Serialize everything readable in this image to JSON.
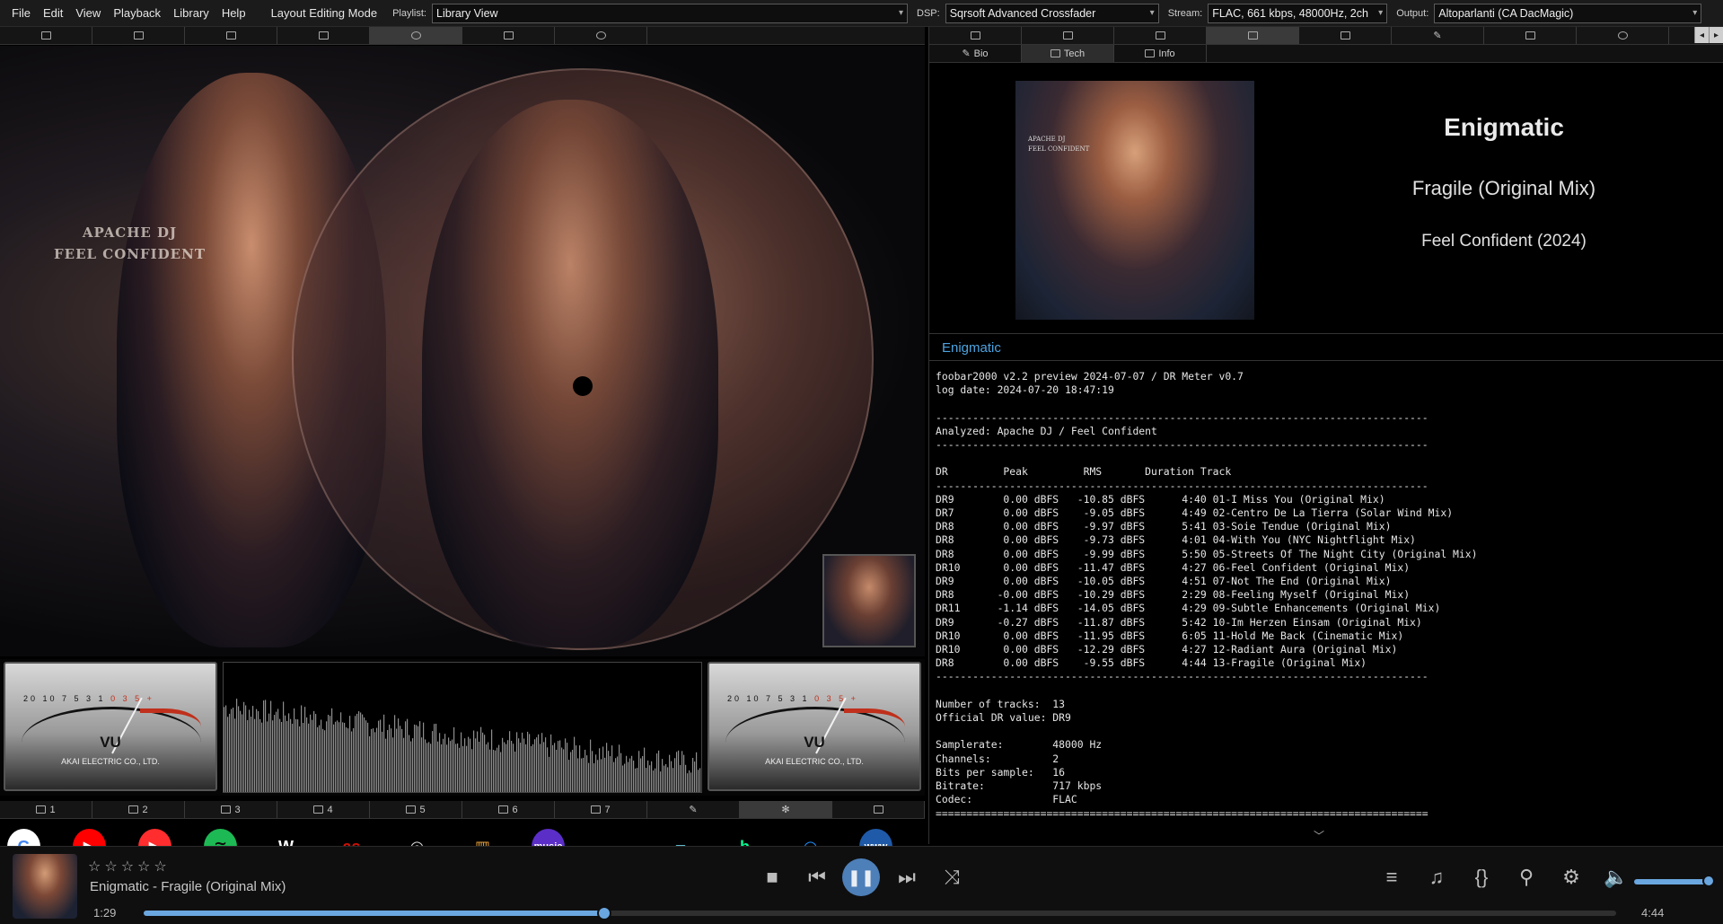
{
  "menubar": {
    "items": [
      "File",
      "Edit",
      "View",
      "Playback",
      "Library",
      "Help"
    ],
    "layout_mode": "Layout Editing Mode",
    "playlist_label": "Playlist:",
    "playlist_value": "Library View",
    "dsp_label": "DSP:",
    "dsp_value": "Sqrsoft Advanced Crossfader",
    "stream_label": "Stream:",
    "stream_value": "FLAC, 661 kbps, 48000Hz, 2ch",
    "output_label": "Output:",
    "output_value": "Altoparlanti (CA DacMagic)"
  },
  "artwork": {
    "caption_line1": "APACHE DJ",
    "caption_line2": "FEEL CONFIDENT"
  },
  "meters": {
    "vu_label": "VU",
    "brand": "AKAI ELECTRIC CO., LTD.",
    "scale": "20 10 7 5 3 1",
    "scale_red": "0 3 5 +"
  },
  "left_bottom_tabs": [
    "1",
    "2",
    "3",
    "4",
    "5",
    "6",
    "7",
    "",
    "",
    ""
  ],
  "services": [
    {
      "name": "google",
      "glyph": "G",
      "bg": "#ffffff",
      "fg": "#4285f4"
    },
    {
      "name": "youtube",
      "glyph": "▶",
      "bg": "#ff0000",
      "fg": "#ffffff"
    },
    {
      "name": "youtube-music",
      "glyph": "▶",
      "bg": "#ff2d2d",
      "fg": "#ffffff"
    },
    {
      "name": "spotify",
      "glyph": "≋",
      "bg": "#1db954",
      "fg": "#0b0b0b"
    },
    {
      "name": "wikipedia",
      "glyph": "W",
      "bg": "#000000",
      "fg": "#ffffff"
    },
    {
      "name": "lastfm",
      "glyph": "as",
      "bg": "#000000",
      "fg": "#d51007"
    },
    {
      "name": "discogs",
      "glyph": "◎",
      "bg": "#000000",
      "fg": "#dddddd"
    },
    {
      "name": "deezer",
      "glyph": "▥",
      "bg": "#000000",
      "fg": "#e8a23b"
    },
    {
      "name": "amazon-music",
      "glyph": "music",
      "bg": "#5b2ec8",
      "fg": "#ffffff"
    },
    {
      "name": "soundcloud",
      "glyph": "☁",
      "bg": "#000000",
      "fg": "#ff5500"
    },
    {
      "name": "tidal",
      "glyph": "▰",
      "bg": "#000000",
      "fg": "#5fb7c9"
    },
    {
      "name": "beatport",
      "glyph": "b",
      "bg": "#000000",
      "fg": "#01ff95"
    },
    {
      "name": "audiomack",
      "glyph": "◠",
      "bg": "#000000",
      "fg": "#1e90ff"
    },
    {
      "name": "www",
      "glyph": "www",
      "bg": "#1f5aa8",
      "fg": "#ffffff"
    }
  ],
  "right_tabs": {
    "subtabs": [
      "Bio",
      "Tech",
      "Info"
    ],
    "active_subtab": "Tech"
  },
  "nowplaying": {
    "title": "Enigmatic",
    "track": "Fragile (Original Mix)",
    "album": "Feel Confident (2024)",
    "cover_caption1": "APACHE DJ",
    "cover_caption2": "FEEL CONFIDENT"
  },
  "log": {
    "panel_title": "Enigmatic",
    "text": "foobar2000 v2.2 preview 2024-07-07 / DR Meter v0.7\nlog date: 2024-07-20 18:47:19\n\n--------------------------------------------------------------------------------\nAnalyzed: Apache DJ / Feel Confident\n--------------------------------------------------------------------------------\n\nDR         Peak         RMS       Duration Track\n--------------------------------------------------------------------------------\nDR9        0.00 dBFS   -10.85 dBFS      4:40 01-I Miss You (Original Mix)\nDR7        0.00 dBFS    -9.05 dBFS      4:49 02-Centro De La Tierra (Solar Wind Mix)\nDR8        0.00 dBFS    -9.97 dBFS      5:41 03-Soie Tendue (Original Mix)\nDR8        0.00 dBFS    -9.73 dBFS      4:01 04-With You (NYC Nightflight Mix)\nDR8        0.00 dBFS    -9.99 dBFS      5:50 05-Streets Of The Night City (Original Mix)\nDR10       0.00 dBFS   -11.47 dBFS      4:27 06-Feel Confident (Original Mix)\nDR9        0.00 dBFS   -10.05 dBFS      4:51 07-Not The End (Original Mix)\nDR8       -0.00 dBFS   -10.29 dBFS      2:29 08-Feeling Myself (Original Mix)\nDR11      -1.14 dBFS   -14.05 dBFS      4:29 09-Subtle Enhancements (Original Mix)\nDR9       -0.27 dBFS   -11.87 dBFS      5:42 10-Im Herzen Einsam (Original Mix)\nDR10       0.00 dBFS   -11.95 dBFS      6:05 11-Hold Me Back (Cinematic Mix)\nDR10       0.00 dBFS   -12.29 dBFS      4:27 12-Radiant Aura (Original Mix)\nDR8        0.00 dBFS    -9.55 dBFS      4:44 13-Fragile (Original Mix)\n--------------------------------------------------------------------------------\n\nNumber of tracks:  13\nOfficial DR value: DR9\n\nSamplerate:        48000 Hz\nChannels:          2\nBits per sample:   16\nBitrate:           717 kbps\nCodec:             FLAC\n================================================================================"
  },
  "footer": {
    "rating": "☆☆☆☆☆",
    "now_playing": "Enigmatic - Fragile (Original Mix)",
    "time_current": "1:29",
    "time_total": "4:44",
    "progress": 0.313,
    "volume": 1.0,
    "accent": "#6aa7e0"
  }
}
